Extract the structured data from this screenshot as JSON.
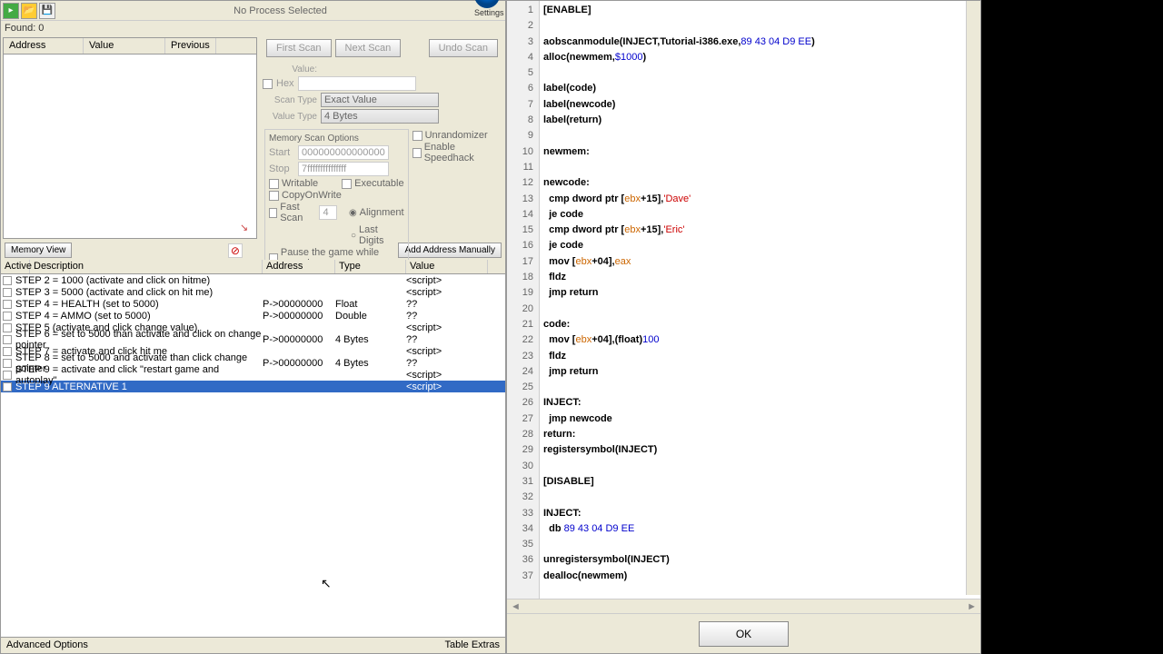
{
  "header": {
    "process": "No Process Selected",
    "found": "Found: 0"
  },
  "listCols": {
    "address": "Address",
    "value": "Value",
    "previous": "Previous"
  },
  "scan": {
    "first": "First Scan",
    "next": "Next Scan",
    "undo": "Undo Scan",
    "valueLbl": "Value:",
    "hex": "Hex",
    "scanTypeLbl": "Scan Type",
    "scanType": "Exact Value",
    "valueTypeLbl": "Value Type",
    "valueType": "4 Bytes",
    "memOpts": "Memory Scan Options",
    "startLbl": "Start",
    "start": "0000000000000000",
    "stopLbl": "Stop",
    "stop": "7fffffffffffffff",
    "writable": "Writable",
    "executable": "Executable",
    "cow": "CopyOnWrite",
    "fastScan": "Fast Scan",
    "fastVal": "4",
    "alignment": "Alignment",
    "lastDigits": "Last Digits",
    "pause": "Pause the game while scanning",
    "unrand": "Unrandomizer",
    "speedhack": "Enable Speedhack",
    "settings": "Settings"
  },
  "mid": {
    "memView": "Memory View",
    "addManual": "Add Address Manually"
  },
  "tableCols": {
    "active": "Active",
    "desc": "Description",
    "addr": "Address",
    "type": "Type",
    "val": "Value"
  },
  "rows": [
    {
      "desc": "STEP 2 = 1000 (activate and click on hitme)",
      "addr": "",
      "type": "",
      "val": "<script>"
    },
    {
      "desc": "STEP 3 = 5000 (activate and click on hit me)",
      "addr": "",
      "type": "",
      "val": "<script>"
    },
    {
      "desc": "STEP 4 = HEALTH (set to 5000)",
      "addr": "P->00000000",
      "type": "Float",
      "val": "??"
    },
    {
      "desc": "STEP 4 = AMMO (set to 5000)",
      "addr": "P->00000000",
      "type": "Double",
      "val": "??"
    },
    {
      "desc": "STEP 5 (activate and click change value)",
      "addr": "",
      "type": "",
      "val": "<script>"
    },
    {
      "desc": "STEP 6 = set to 5000 than activate and click on change pointer",
      "addr": "P->00000000",
      "type": "4 Bytes",
      "val": "??"
    },
    {
      "desc": "STEP 7 = activate and click hit me",
      "addr": "",
      "type": "",
      "val": "<script>"
    },
    {
      "desc": "STEP 8 = set to 5000 and activate than click change pointer",
      "addr": "P->00000000",
      "type": "4 Bytes",
      "val": "??"
    },
    {
      "desc": "STEP 9 = activate and click \"restart game and autoplay\"",
      "addr": "",
      "type": "",
      "val": "<script>"
    },
    {
      "desc": "STEP 9 ALTERNATIVE 1",
      "addr": "",
      "type": "",
      "val": "<script>",
      "sel": true
    }
  ],
  "footer": {
    "adv": "Advanced Options",
    "extras": "Table Extras"
  },
  "code": [
    {
      "t": "[ENABLE]",
      "c": "sect"
    },
    {
      "t": ""
    },
    {
      "t": "aobscanmodule(INJECT,Tutorial-i386.exe,",
      "tail": "89 43 04 D9 EE",
      "tc": "num",
      "after": ")"
    },
    {
      "t": "alloc(newmem,",
      "tail": "$1000",
      "tc": "num",
      "after": ")"
    },
    {
      "t": ""
    },
    {
      "t": "label(code)"
    },
    {
      "t": "label(newcode)"
    },
    {
      "t": "label(return)"
    },
    {
      "t": ""
    },
    {
      "t": "newmem:"
    },
    {
      "t": ""
    },
    {
      "t": "newcode:"
    },
    {
      "t": "  cmp dword ptr [",
      "reg": "ebx",
      "mid": "+15],",
      "str": "'Dave'"
    },
    {
      "t": "  je code"
    },
    {
      "t": "  cmp dword ptr [",
      "reg": "ebx",
      "mid": "+15],",
      "str": "'Eric'"
    },
    {
      "t": "  je code"
    },
    {
      "t": "  mov [",
      "reg": "ebx",
      "mid": "+04],",
      "reg2": "eax"
    },
    {
      "t": "  fldz"
    },
    {
      "t": "  jmp return"
    },
    {
      "t": ""
    },
    {
      "t": "code:"
    },
    {
      "t": "  mov [",
      "reg": "ebx",
      "mid": "+04],(float)",
      "num": "100"
    },
    {
      "t": "  fldz"
    },
    {
      "t": "  jmp return"
    },
    {
      "t": ""
    },
    {
      "t": "INJECT:"
    },
    {
      "t": "  jmp newcode"
    },
    {
      "t": "return:"
    },
    {
      "t": "registersymbol(INJECT)"
    },
    {
      "t": ""
    },
    {
      "t": "[DISABLE]",
      "c": "sect"
    },
    {
      "t": ""
    },
    {
      "t": "INJECT:"
    },
    {
      "t": "  db ",
      "tail": "89 43 04 D9 EE",
      "tc": "num"
    },
    {
      "t": ""
    },
    {
      "t": "unregistersymbol(INJECT)"
    },
    {
      "t": "dealloc(newmem)"
    }
  ],
  "ok": "OK"
}
